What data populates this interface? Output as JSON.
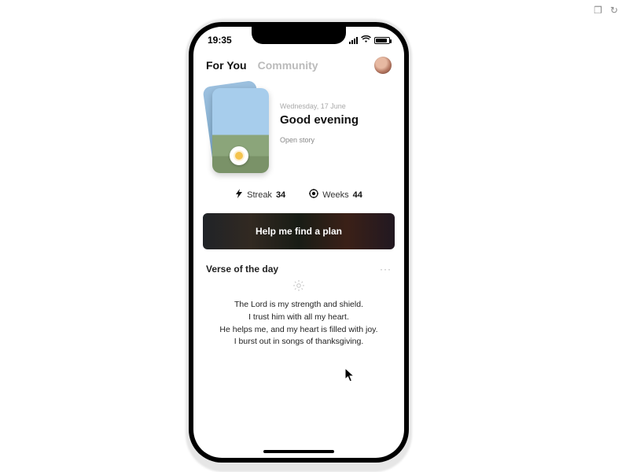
{
  "status": {
    "time": "19:35"
  },
  "nav": {
    "tab_for_you": "For You",
    "tab_community": "Community"
  },
  "hero": {
    "date_line": "Wednesday, 17 June",
    "greeting": "Good evening",
    "open_story": "Open story"
  },
  "stats": {
    "streak_label": "Streak",
    "streak_value": "34",
    "weeks_label": "Weeks",
    "weeks_value": "44"
  },
  "banner": {
    "label": "Help me find a plan"
  },
  "verse": {
    "section_title": "Verse of the day",
    "body": "The Lord is my strength and shield.\nI trust him with all my heart.\nHe helps me, and my heart is filled with joy.\nI burst out in songs of thanksgiving."
  }
}
